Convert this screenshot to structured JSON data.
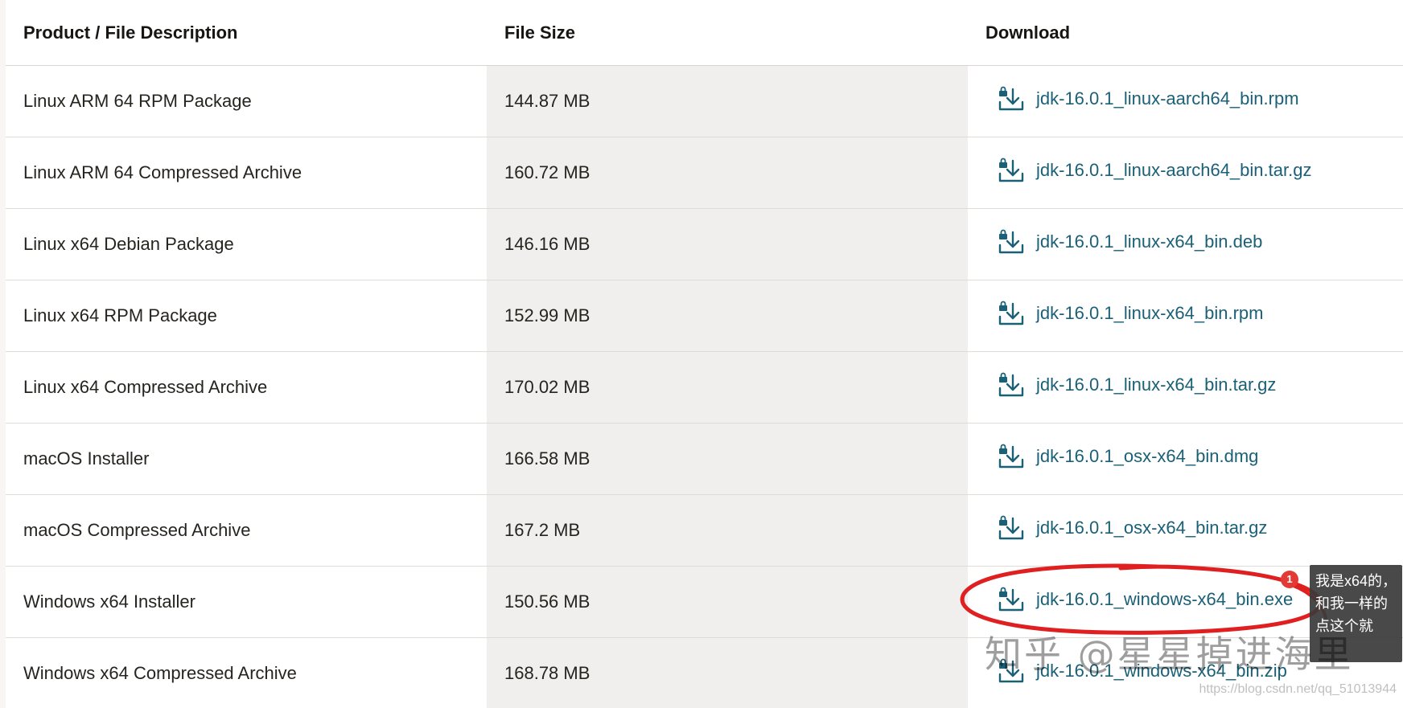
{
  "table": {
    "headers": {
      "product": "Product / File Description",
      "size": "File Size",
      "download": "Download"
    },
    "rows": [
      {
        "product": "Linux ARM 64 RPM Package",
        "size": "144.87 MB",
        "file": "jdk-16.0.1_linux-aarch64_bin.rpm"
      },
      {
        "product": "Linux ARM 64 Compressed Archive",
        "size": "160.72 MB",
        "file": "jdk-16.0.1_linux-aarch64_bin.tar.gz"
      },
      {
        "product": "Linux x64 Debian Package",
        "size": "146.16 MB",
        "file": "jdk-16.0.1_linux-x64_bin.deb"
      },
      {
        "product": "Linux x64 RPM Package",
        "size": "152.99 MB",
        "file": "jdk-16.0.1_linux-x64_bin.rpm"
      },
      {
        "product": "Linux x64 Compressed Archive",
        "size": "170.02 MB",
        "file": "jdk-16.0.1_linux-x64_bin.tar.gz"
      },
      {
        "product": "macOS Installer",
        "size": "166.58 MB",
        "file": "jdk-16.0.1_osx-x64_bin.dmg"
      },
      {
        "product": "macOS Compressed Archive",
        "size": "167.2 MB",
        "file": "jdk-16.0.1_osx-x64_bin.tar.gz"
      },
      {
        "product": "Windows x64 Installer",
        "size": "150.56 MB",
        "file": "jdk-16.0.1_windows-x64_bin.exe"
      },
      {
        "product": "Windows x64 Compressed Archive",
        "size": "168.78 MB",
        "file": "jdk-16.0.1_windows-x64_bin.zip"
      }
    ]
  },
  "annotation": {
    "badge_count": "1",
    "comment_text": "我是x64的，和我一样的点这个就",
    "highlight_color": "#e02020"
  },
  "watermark": {
    "zhihu": "知乎 @星星掉进海里",
    "csdn": "https://blog.csdn.net/qq_51013944"
  },
  "colors": {
    "link": "#1a6077",
    "shade_column": "#f1efed",
    "row_divider": "#dfdcd8"
  },
  "icons": {
    "download": "download-lock-icon"
  }
}
